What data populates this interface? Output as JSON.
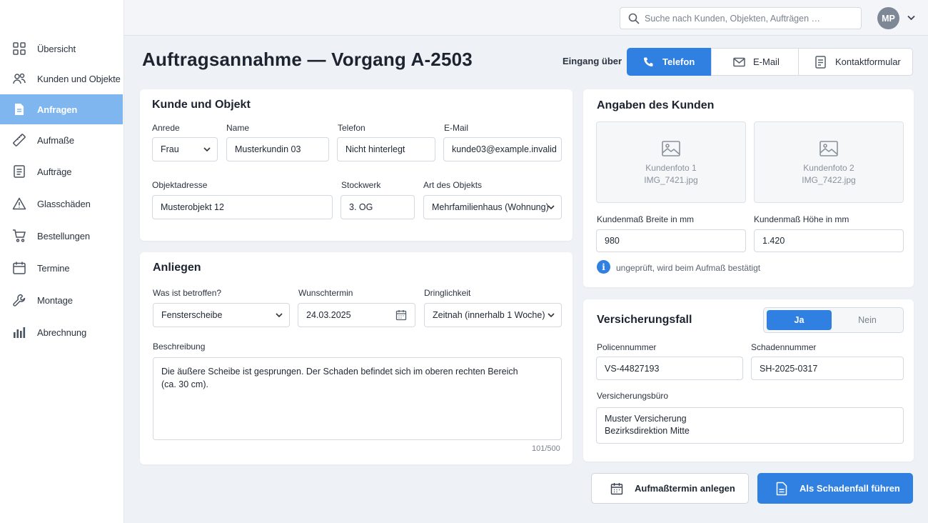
{
  "sidebar": {
    "items": [
      {
        "label": "Übersicht",
        "icon": "grid-icon"
      },
      {
        "label": "Kunden und Objekte",
        "icon": "users-icon"
      },
      {
        "label": "Anfragen",
        "icon": "document-icon",
        "active": true
      },
      {
        "label": "Aufmaße",
        "icon": "ruler-icon"
      },
      {
        "label": "Aufträge",
        "icon": "list-document-icon"
      },
      {
        "label": "Glasschäden",
        "icon": "warning-icon"
      },
      {
        "label": "Bestellungen",
        "icon": "cart-icon"
      },
      {
        "label": "Termine",
        "icon": "calendar-icon"
      },
      {
        "label": "Montage",
        "icon": "wrench-icon"
      },
      {
        "label": "Abrechnung",
        "icon": "bar-chart-icon"
      }
    ]
  },
  "topbar": {
    "search_placeholder": "Suche nach Kunden, Objekten, Aufträgen …",
    "user_initials": "MP"
  },
  "header": {
    "title": "Auftragsannahme — Vorgang A-2503",
    "channel_label": "Eingang über",
    "channels": [
      {
        "label": "Telefon",
        "selected": true
      },
      {
        "label": "E-Mail",
        "selected": false
      },
      {
        "label": "Kontaktformular",
        "selected": false
      }
    ]
  },
  "kunde": {
    "title": "Kunde und Objekt",
    "anrede_label": "Anrede",
    "anrede_value": "Frau",
    "name_label": "Name",
    "name_value": "Musterkundin 03",
    "telefon_label": "Telefon",
    "telefon_value": "Nicht hinterlegt",
    "email_label": "E-Mail",
    "email_value": "kunde03@example.invalid",
    "adresse_label": "Objektadresse",
    "adresse_value": "Musterobjekt 12",
    "stockwerk_label": "Stockwerk",
    "stockwerk_value": "3. OG",
    "art_label": "Art des Objekts",
    "art_value": "Mehrfamilienhaus (Wohnung)"
  },
  "anliegen": {
    "title": "Anliegen",
    "betroffen_label": "Was ist betroffen?",
    "betroffen_value": "Fensterscheibe",
    "termin_label": "Wunschtermin",
    "termin_value": "24.03.2025",
    "dringlichkeit_label": "Dringlichkeit",
    "dringlichkeit_value": "Zeitnah (innerhalb 1 Woche)",
    "beschreibung_label": "Beschreibung",
    "beschreibung_line1": "Die äußere Scheibe ist gesprungen. Der Schaden befindet sich im oberen rechten Bereich",
    "beschreibung_line2": "(ca. 30 cm).",
    "counter": "101/500"
  },
  "angaben": {
    "title": "Angaben des Kunden",
    "photos": [
      {
        "title": "Kundenfoto 1",
        "file": "IMG_7421.jpg"
      },
      {
        "title": "Kundenfoto 2",
        "file": "IMG_7422.jpg"
      }
    ],
    "breite_label": "Kundenmaß Breite in mm",
    "breite_value": "980",
    "hoehe_label": "Kundenmaß Höhe in mm",
    "hoehe_value": "1.420",
    "hint": "ungeprüft, wird beim Aufmaß bestätigt"
  },
  "versicherung": {
    "title": "Versicherungsfall",
    "toggle_yes": "Ja",
    "toggle_no": "Nein",
    "toggle_selected": "Ja",
    "police_label": "Policennummer",
    "police_value": "VS-44827193",
    "schaden_label": "Schadennummer",
    "schaden_value": "SH-2025-0317",
    "buero_label": "Versicherungsbüro",
    "buero_line1": "Muster Versicherung",
    "buero_line2": "Bezirksdirektion Mitte"
  },
  "actions": {
    "secondary": "Aufmaßtermin anlegen",
    "primary": "Als Schadenfall führen"
  },
  "colors": {
    "accent": "#2f80e0",
    "sidebar_active": "#7fb6f0",
    "background": "#eef1f5"
  }
}
